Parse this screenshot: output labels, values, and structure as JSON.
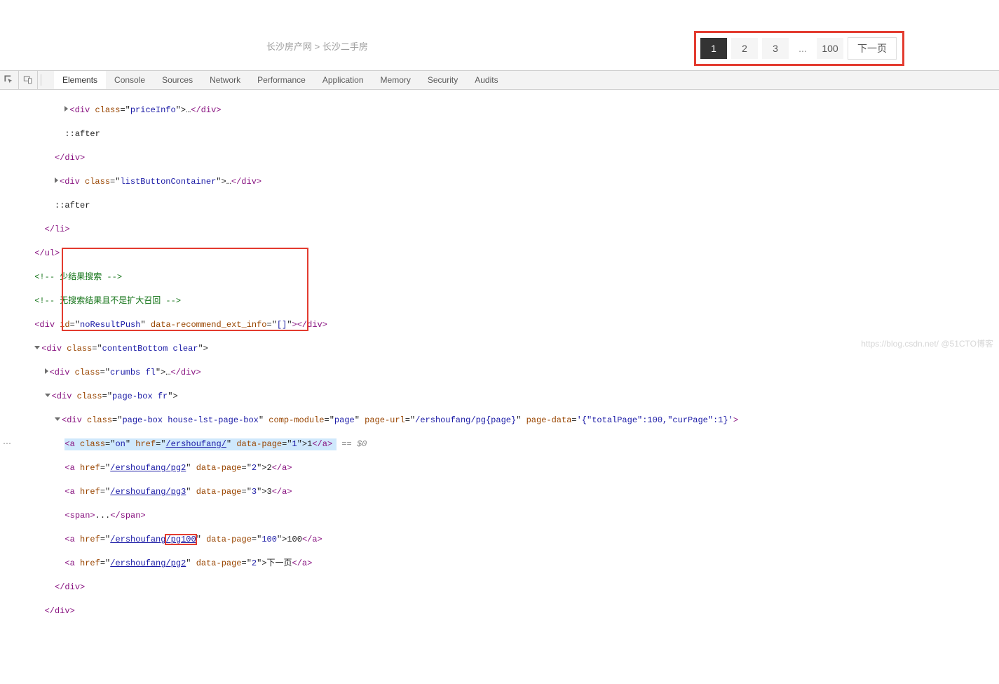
{
  "breadcrumb": {
    "home": "长沙房产网",
    "sep": ">",
    "current": "长沙二手房"
  },
  "pagination": {
    "current": "1",
    "p2": "2",
    "p3": "3",
    "ellipsis": "...",
    "p100": "100",
    "next": "下一页"
  },
  "devtools": {
    "tabs": {
      "elements": "Elements",
      "console": "Console",
      "sources": "Sources",
      "network": "Network",
      "performance": "Performance",
      "application": "Application",
      "memory": "Memory",
      "security": "Security",
      "audits": "Audits"
    },
    "code": {
      "l1": {
        "open": "<div ",
        "a1": "class",
        "eq": "=\"",
        "v1": "priceInfo",
        "close": "\">",
        "dots": "…",
        "end": "</div>"
      },
      "l2": "::after",
      "l3": "</div>",
      "l4": {
        "open": "<div ",
        "a1": "class",
        "eq": "=\"",
        "v1": "listButtonContainer",
        "close": "\">",
        "dots": "…",
        "end": "</div>"
      },
      "l5": "::after",
      "l6": "</li>",
      "l7": "</ul>",
      "l8": "<!-- 少结果搜索 -->",
      "l9": "<!-- 无搜索结果且不是扩大召回 -->",
      "l10": {
        "open": "<div ",
        "a1": "id",
        "v1": "noResultPush",
        "a2": "data-recommend_ext_info",
        "v2": "[]",
        "end": "></div>"
      },
      "l11": {
        "open": "<div ",
        "a1": "class",
        "v1": "contentBottom clear",
        "close": "\">"
      },
      "l12": {
        "open": "<div ",
        "a1": "class",
        "v1": "crumbs fl",
        "close": "\">",
        "dots": "…",
        "end": "</div>"
      },
      "l13": {
        "open": "<div ",
        "a1": "class",
        "v1": "page-box fr",
        "close": "\">"
      },
      "l14": {
        "open": "<div ",
        "a1": "class",
        "v1": "page-box house-lst-page-box",
        "a2": "comp-module",
        "v2": "page",
        "a3": "page-url",
        "v3": "/ershoufang/pg{page}",
        "a4": "page-data",
        "v4": "'{\"totalPage\":100,\"curPage\":1}'",
        "close": ">"
      },
      "l15": {
        "open": "<a ",
        "a1": "class",
        "v1": "on",
        "a2": "href",
        "v2": "/ershoufang/",
        "a3": "data-page",
        "v3": "1",
        "txt": "1",
        "end": "</a>",
        "sel": " == $0"
      },
      "l16": {
        "open": "<a ",
        "a1": "href",
        "v1": "/ershoufang/pg2",
        "a2": "data-page",
        "v2": "2",
        "txt": "2",
        "end": "</a>"
      },
      "l17": {
        "open": "<a ",
        "a1": "href",
        "v1": "/ershoufang/pg3",
        "a2": "data-page",
        "v2": "3",
        "txt": "3",
        "end": "</a>"
      },
      "l18": {
        "open": "<span>",
        "txt": "...",
        "end": "</span>"
      },
      "l19": {
        "open": "<a ",
        "a1": "href",
        "v1_pre": "/ershoufang",
        "v1_box": "/pg100",
        "a2": "data-page",
        "v2": "100",
        "txt": "100",
        "end": "</a>"
      },
      "l20": {
        "open": "<a ",
        "a1": "href",
        "v1": "/ershoufang/pg2",
        "a2": "data-page",
        "v2": "2",
        "txt": "下一页",
        "end": "</a>"
      },
      "l21": "</div>",
      "l22": "</div>"
    }
  },
  "watermark": "https://blog.csdn.net/  @51CTO博客"
}
